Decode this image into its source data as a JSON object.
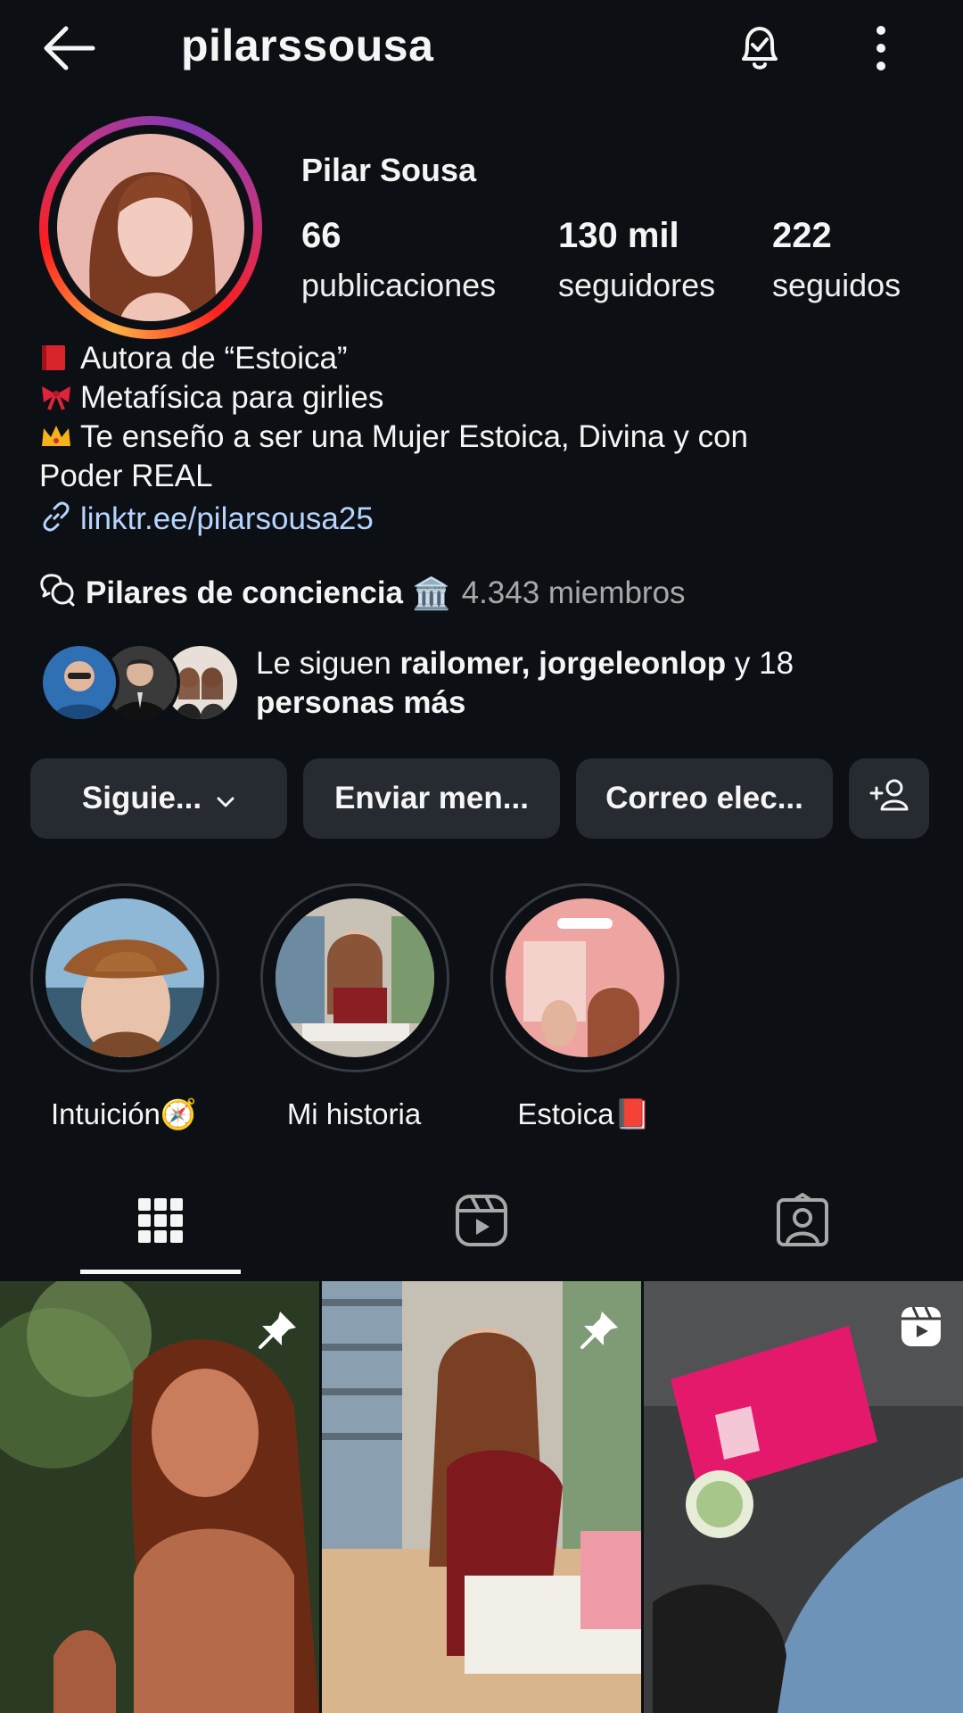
{
  "header": {
    "username": "pilarssousa",
    "back_icon": "arrow-left-icon",
    "notifications_icon": "bell-check-icon",
    "more_icon": "vertical-dots-icon"
  },
  "profile": {
    "display_name": "Pilar Sousa",
    "stats": [
      {
        "value": "66",
        "label": "publicaciones"
      },
      {
        "value": "130 mil",
        "label": "seguidores"
      },
      {
        "value": "222",
        "label": "seguidos"
      }
    ],
    "bio": {
      "line1": "Autora de “Estoica”",
      "line2": "Metafísica para girlies",
      "line3a": "Te enseño a ser una Mujer Estoica, Divina y con",
      "line3b": "Poder REAL",
      "link": "linktr.ee/pilarsousa25"
    },
    "community": {
      "name": "Pilares de conciencia",
      "emoji": "🏛️",
      "members": "4.343 miembros"
    },
    "followed_by": {
      "prefix": "Le siguen ",
      "names": "railomer, jorgeleonlop",
      "suffix": " y 18",
      "line2": "personas más"
    }
  },
  "buttons": {
    "following": "Siguie...",
    "message": "Enviar men...",
    "email": "Correo elec...",
    "add_user_icon": "add-person-icon"
  },
  "highlights": [
    {
      "label": "Intuición🧭"
    },
    {
      "label": "Mi historia"
    },
    {
      "label": "Estoica📕"
    }
  ],
  "tabs": [
    {
      "icon": "grid-icon",
      "active": true
    },
    {
      "icon": "reels-icon",
      "active": false
    },
    {
      "icon": "tagged-icon",
      "active": false
    }
  ],
  "grid": [
    {
      "pinned": true,
      "type": "photo"
    },
    {
      "pinned": true,
      "type": "photo"
    },
    {
      "pinned": false,
      "type": "reel"
    }
  ],
  "colors": {
    "background": "#0c1014",
    "button": "#262a31",
    "link": "#b6d4ff",
    "muted": "#a8a8a8"
  }
}
